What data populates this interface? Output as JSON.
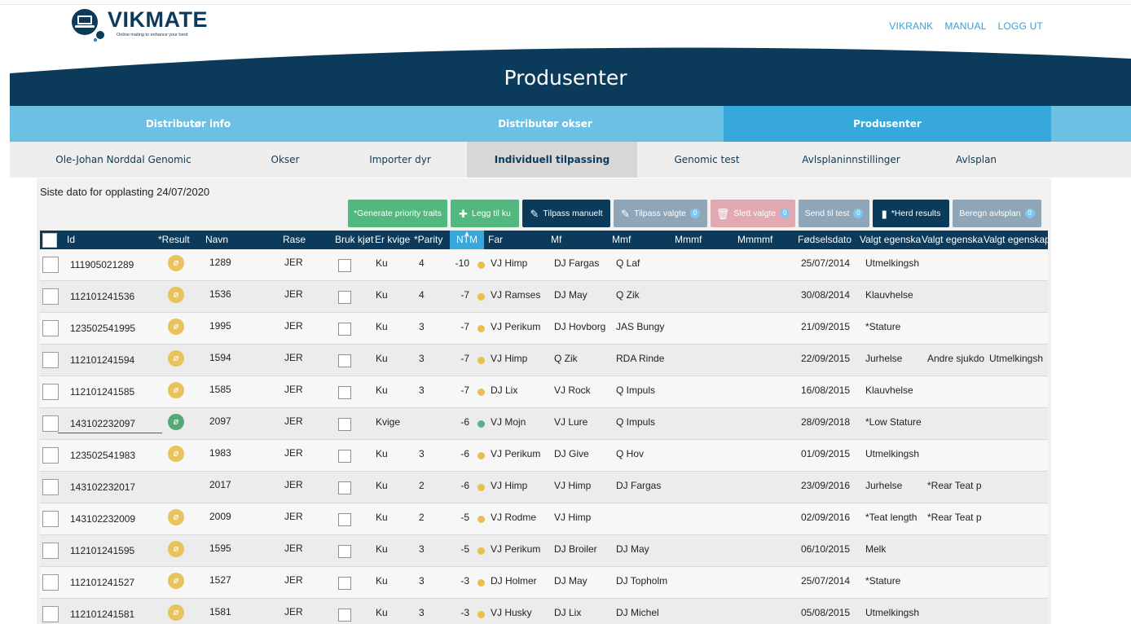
{
  "app": {
    "logo_text": "VIKMATE",
    "logo_tagline": "Online mating to enhance your herd",
    "top_links": [
      "VIKRANK",
      "MANUAL",
      "LOGG UT"
    ],
    "banner_title": "Produsenter"
  },
  "main_tabs": [
    {
      "label": "Distributør info"
    },
    {
      "label": "Distributør okser"
    },
    {
      "label": "Produsenter"
    }
  ],
  "sub_tabs": [
    {
      "label": "Ole-Johan Norddal Genomic"
    },
    {
      "label": "Okser"
    },
    {
      "label": "Importer dyr"
    },
    {
      "label": "Individuell tilpassing"
    },
    {
      "label": "Genomic test"
    },
    {
      "label": "Avlsplaninnstillinger"
    },
    {
      "label": "Avlsplan"
    }
  ],
  "upload_date_text": "Siste dato for opplasting 24/07/2020",
  "toolbar": {
    "generate": "*Generate priority traits",
    "add_cow": "Legg til ku",
    "adjust_manual": "Tilpass manuelt",
    "adjust_selected": "Tilpass valgte",
    "adjust_selected_count": "0",
    "delete_selected": "Slett valgte",
    "delete_selected_count": "0",
    "send_test": "Send til test",
    "send_test_count": "0",
    "herd_results": "*Herd results",
    "calc_plan": "Beregn avlsplan",
    "calc_plan_count": "0"
  },
  "table": {
    "columns": {
      "id": "Id",
      "result": "*Result",
      "navn": "Navn",
      "rase": "Rase",
      "bruk": "Bruk kjøttfe",
      "kvige": "Er kvige",
      "parity": "*Parity",
      "ntm": "NTM",
      "far": "Far",
      "mf": "Mf",
      "mmf": "Mmf",
      "mmmf": "Mmmf",
      "mmmmf": "Mmmmf",
      "fodsel": "Fødselsdato",
      "eg1": "Valgt egenskap",
      "eg2": "Valgt egenskap",
      "eg3": "Valgt egenskap"
    },
    "colors": {
      "yellow": "#e8c25a",
      "green": "#56a879",
      "dot_yellow": "#e8c04c",
      "dot_green": "#5ab08d"
    },
    "rows": [
      {
        "id": "111905021289",
        "result": "yellow",
        "navn": "1289",
        "rase": "JER",
        "kvige": "Ku",
        "parity": "4",
        "ntm": "-10",
        "dot": "yellow",
        "far": "VJ Himp",
        "mf": "DJ Fargas",
        "mmf": "Q Laf",
        "mmmf": "",
        "mmmmf": "",
        "fodsel": "25/07/2014",
        "eg1": "Utmelkingsh",
        "eg2": "",
        "eg3": ""
      },
      {
        "id": "112101241536",
        "result": "yellow",
        "navn": "1536",
        "rase": "JER",
        "kvige": "Ku",
        "parity": "4",
        "ntm": "-7",
        "dot": "yellow",
        "far": "VJ Ramses",
        "mf": "DJ May",
        "mmf": "Q Zik",
        "mmmf": "",
        "mmmmf": "",
        "fodsel": "30/08/2014",
        "eg1": "Klauvhelse",
        "eg2": "",
        "eg3": ""
      },
      {
        "id": "123502541995",
        "result": "yellow",
        "navn": "1995",
        "rase": "JER",
        "kvige": "Ku",
        "parity": "3",
        "ntm": "-7",
        "dot": "yellow",
        "far": "VJ Perikum",
        "mf": "DJ Hovborg",
        "mmf": "JAS Bungy",
        "mmmf": "",
        "mmmmf": "",
        "fodsel": "21/09/2015",
        "eg1": "*Stature",
        "eg2": "",
        "eg3": ""
      },
      {
        "id": "112101241594",
        "result": "yellow",
        "navn": "1594",
        "rase": "JER",
        "kvige": "Ku",
        "parity": "3",
        "ntm": "-7",
        "dot": "yellow",
        "far": "VJ Himp",
        "mf": "Q Zik",
        "mmf": "RDA Rinde",
        "mmmf": "",
        "mmmmf": "",
        "fodsel": "22/09/2015",
        "eg1": "Jurhelse",
        "eg2": "Andre sjukdo",
        "eg3": "Utmelkingsh"
      },
      {
        "id": "112101241585",
        "result": "yellow",
        "navn": "1585",
        "rase": "JER",
        "kvige": "Ku",
        "parity": "3",
        "ntm": "-7",
        "dot": "yellow",
        "far": "DJ Lix",
        "mf": "VJ Rock",
        "mmf": "Q Impuls",
        "mmmf": "",
        "mmmmf": "",
        "fodsel": "16/08/2015",
        "eg1": "Klauvhelse",
        "eg2": "",
        "eg3": ""
      },
      {
        "id": "143102232097",
        "result": "green",
        "navn": "2097",
        "rase": "JER",
        "kvige": "Kvige",
        "parity": "",
        "ntm": "-6",
        "dot": "green",
        "far": "VJ Mojn",
        "mf": "VJ Lure",
        "mmf": "Q Impuls",
        "mmmf": "",
        "mmmmf": "",
        "fodsel": "28/09/2018",
        "eg1": "*Low Stature",
        "eg2": "",
        "eg3": ""
      },
      {
        "id": "123502541983",
        "result": "yellow",
        "navn": "1983",
        "rase": "JER",
        "kvige": "Ku",
        "parity": "3",
        "ntm": "-6",
        "dot": "yellow",
        "far": "VJ Perikum",
        "mf": "DJ Give",
        "mmf": "Q Hov",
        "mmmf": "",
        "mmmmf": "",
        "fodsel": "01/09/2015",
        "eg1": "Utmelkingsh",
        "eg2": "",
        "eg3": ""
      },
      {
        "id": "143102232017",
        "result": "",
        "navn": "2017",
        "rase": "JER",
        "kvige": "Ku",
        "parity": "2",
        "ntm": "-6",
        "dot": "yellow",
        "far": "VJ Himp",
        "mf": "VJ Himp",
        "mmf": "DJ Fargas",
        "mmmf": "",
        "mmmmf": "",
        "fodsel": "23/09/2016",
        "eg1": "Jurhelse",
        "eg2": "*Rear Teat p",
        "eg3": ""
      },
      {
        "id": "143102232009",
        "result": "yellow",
        "navn": "2009",
        "rase": "JER",
        "kvige": "Ku",
        "parity": "2",
        "ntm": "-5",
        "dot": "yellow",
        "far": "VJ Rodme",
        "mf": "VJ Himp",
        "mmf": "",
        "mmmf": "",
        "mmmmf": "",
        "fodsel": "02/09/2016",
        "eg1": "*Teat length",
        "eg2": "*Rear Teat p",
        "eg3": ""
      },
      {
        "id": "112101241595",
        "result": "yellow",
        "navn": "1595",
        "rase": "JER",
        "kvige": "Ku",
        "parity": "3",
        "ntm": "-5",
        "dot": "yellow",
        "far": "VJ Perikum",
        "mf": "DJ Broiler",
        "mmf": "DJ May",
        "mmmf": "",
        "mmmmf": "",
        "fodsel": "06/10/2015",
        "eg1": "Melk",
        "eg2": "",
        "eg3": ""
      },
      {
        "id": "112101241527",
        "result": "yellow",
        "navn": "1527",
        "rase": "JER",
        "kvige": "Ku",
        "parity": "3",
        "ntm": "-3",
        "dot": "yellow",
        "far": "DJ Holmer",
        "mf": "DJ May",
        "mmf": "DJ Topholm",
        "mmmf": "",
        "mmmmf": "",
        "fodsel": "25/07/2014",
        "eg1": "*Stature",
        "eg2": "",
        "eg3": ""
      },
      {
        "id": "112101241581",
        "result": "yellow",
        "navn": "1581",
        "rase": "JER",
        "kvige": "Ku",
        "parity": "3",
        "ntm": "-3",
        "dot": "yellow",
        "far": "VJ Husky",
        "mf": "DJ Lix",
        "mmf": "DJ Michel",
        "mmmf": "",
        "mmmmf": "",
        "fodsel": "05/08/2015",
        "eg1": "Utmelkingsh",
        "eg2": "",
        "eg3": ""
      }
    ]
  }
}
